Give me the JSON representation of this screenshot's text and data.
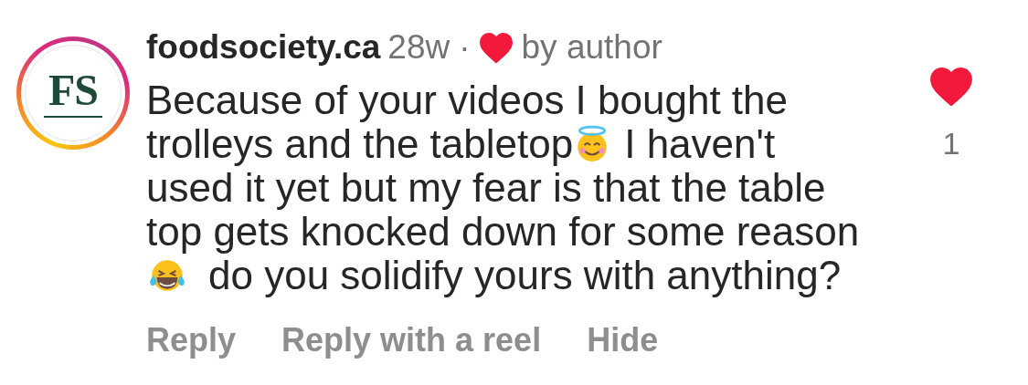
{
  "comment": {
    "avatar": {
      "monogram": "FS",
      "has_story": true
    },
    "username": "foodsociety.ca",
    "time": "28w",
    "separator": "·",
    "liked_by_author": true,
    "author_label": "by author",
    "body_lines": [
      [
        {
          "kind": "text",
          "text": "Because of your videos I bought the"
        }
      ],
      [
        {
          "kind": "text",
          "text": "trolleys and the tabletop"
        },
        {
          "kind": "halo_emoji"
        },
        {
          "kind": "text",
          "text": "I haven't"
        }
      ],
      [
        {
          "kind": "text",
          "text": "used it yet but my fear is that the table"
        }
      ],
      [
        {
          "kind": "text",
          "text": "top gets knocked down for some reason"
        }
      ],
      [
        {
          "kind": "laughing_emoji"
        },
        {
          "kind": "text",
          "text": "do you solidify yours with anything?"
        }
      ]
    ],
    "liked": true,
    "like_count": "1",
    "actions": [
      "Reply",
      "Reply with a reel",
      "Hide"
    ]
  }
}
